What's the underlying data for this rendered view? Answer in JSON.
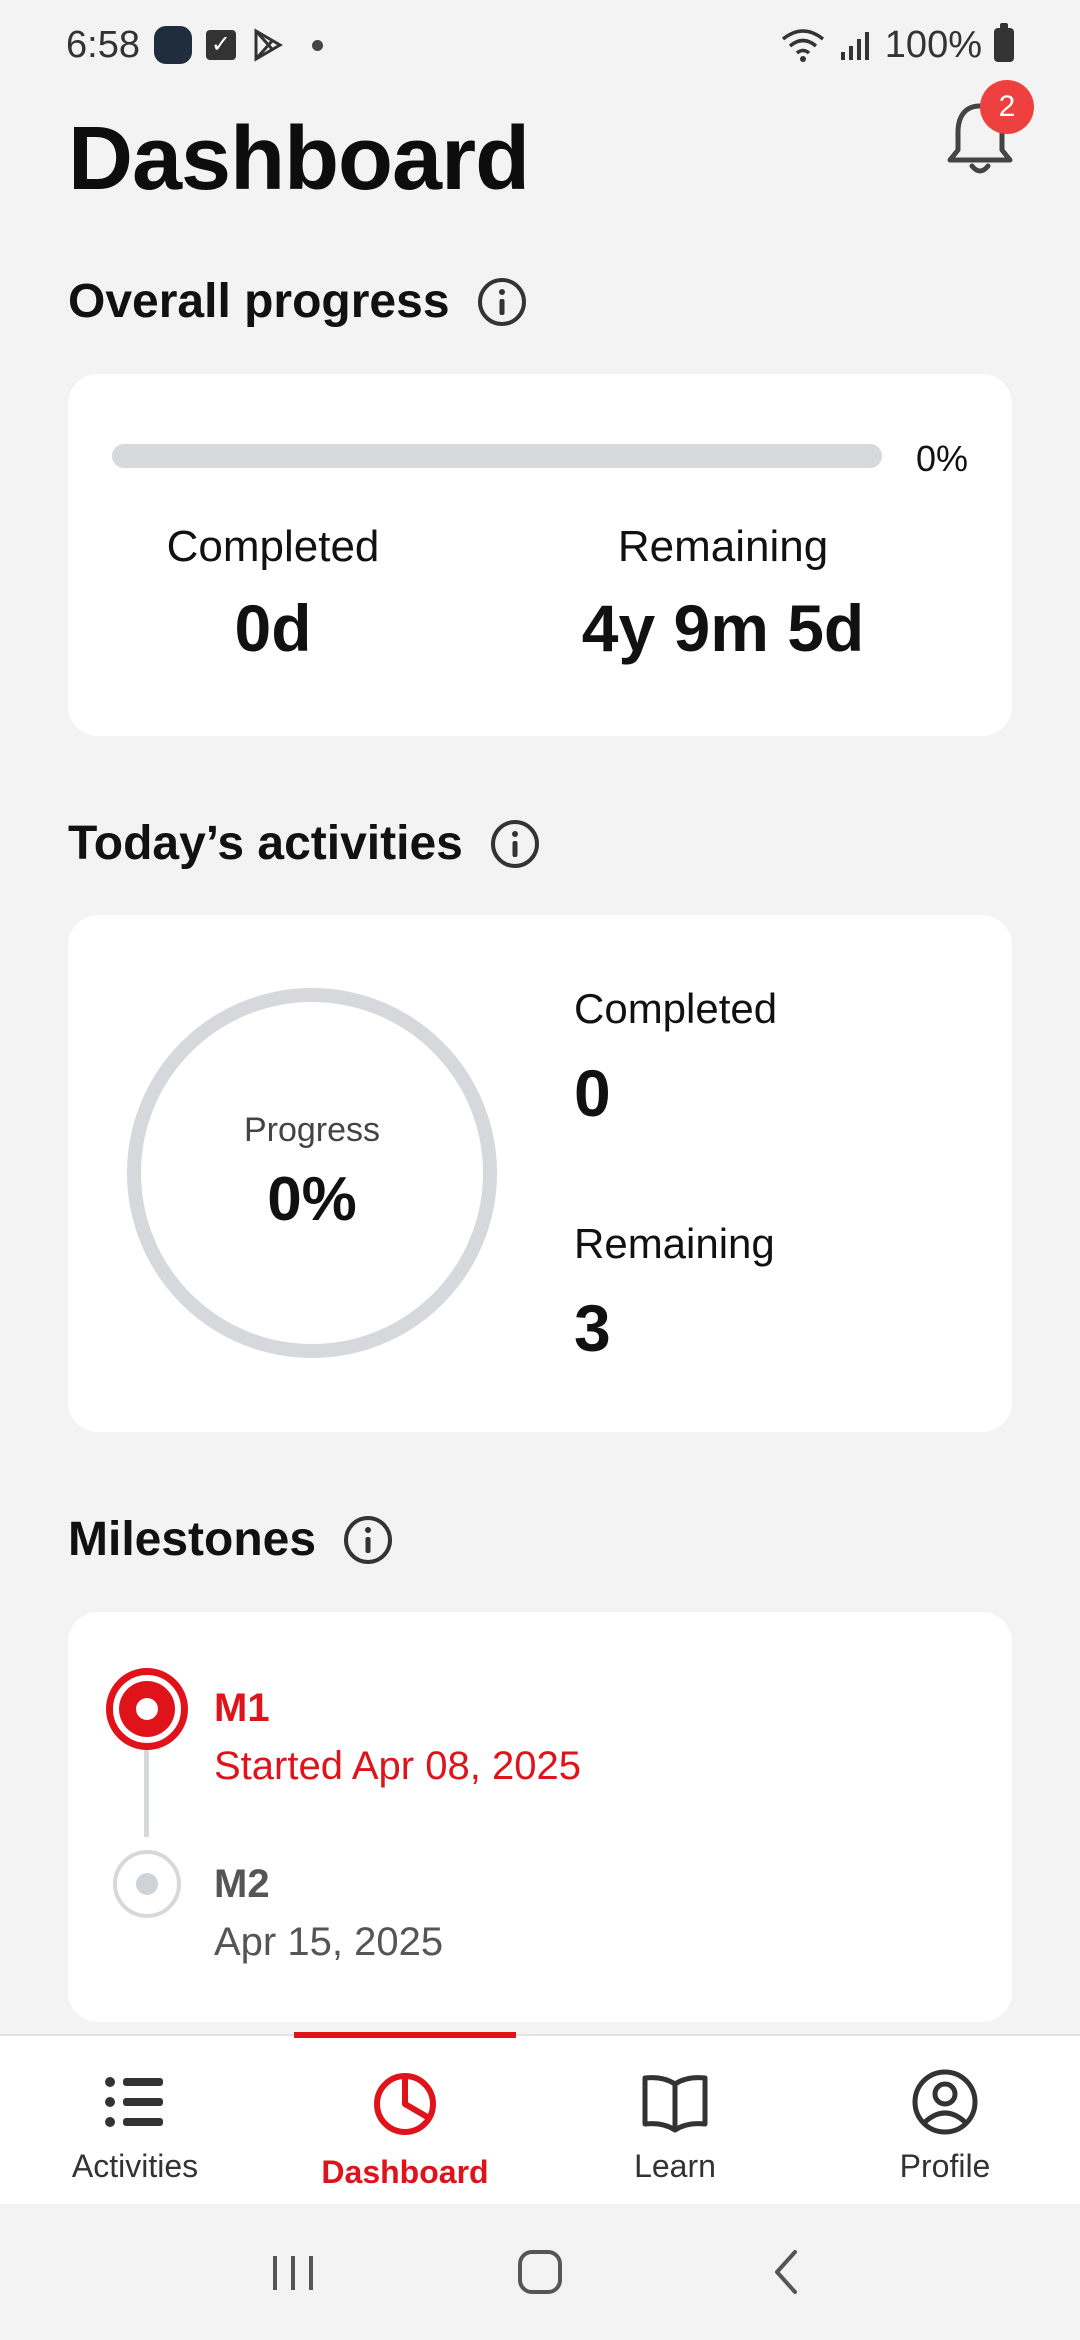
{
  "status_bar": {
    "time": "6:58",
    "battery": "100%"
  },
  "header": {
    "title": "Dashboard",
    "notification_count": "2"
  },
  "overall_progress": {
    "title": "Overall progress",
    "progress_fraction": 0,
    "percent_text": "0%",
    "completed_label": "Completed",
    "completed_value": "0d",
    "remaining_label": "Remaining",
    "remaining_value": "4y 9m 5d"
  },
  "todays_activities": {
    "title": "Today’s activities",
    "ring_label": "Progress",
    "ring_value": "0%",
    "progress_fraction": 0,
    "completed_label": "Completed",
    "completed_value": "0",
    "remaining_label": "Remaining",
    "remaining_value": "3"
  },
  "milestones": {
    "title": "Milestones",
    "items": [
      {
        "name": "M1",
        "date": "Started Apr 08, 2025",
        "state": "active"
      },
      {
        "name": "M2",
        "date": "Apr 15, 2025",
        "state": "upcoming"
      }
    ]
  },
  "bottom_nav": {
    "items": [
      {
        "label": "Activities",
        "icon": "list-icon"
      },
      {
        "label": "Dashboard",
        "icon": "pie-chart-icon",
        "active": true
      },
      {
        "label": "Learn",
        "icon": "book-icon"
      },
      {
        "label": "Profile",
        "icon": "user-circle-icon"
      }
    ]
  },
  "colors": {
    "accent": "#e0131b",
    "badge": "#ef4040",
    "track": "#d6d8db",
    "background": "#f3f3f4"
  }
}
